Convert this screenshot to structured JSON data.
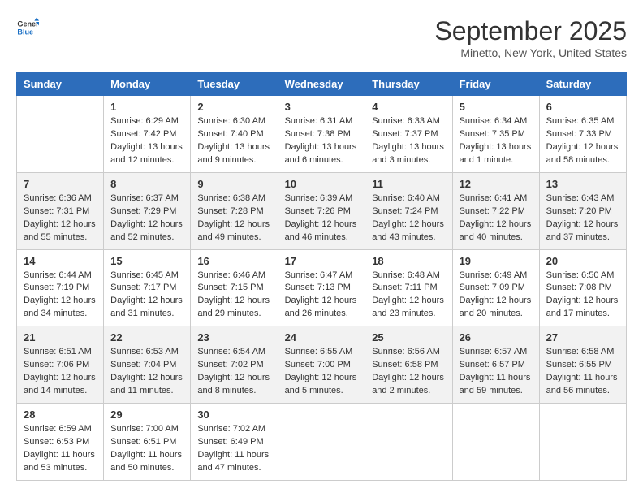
{
  "header": {
    "logo_line1": "General",
    "logo_line2": "Blue",
    "month": "September 2025",
    "location": "Minetto, New York, United States"
  },
  "weekdays": [
    "Sunday",
    "Monday",
    "Tuesday",
    "Wednesday",
    "Thursday",
    "Friday",
    "Saturday"
  ],
  "weeks": [
    [
      {
        "day": "",
        "sunrise": "",
        "sunset": "",
        "daylight": ""
      },
      {
        "day": "1",
        "sunrise": "Sunrise: 6:29 AM",
        "sunset": "Sunset: 7:42 PM",
        "daylight": "Daylight: 13 hours and 12 minutes."
      },
      {
        "day": "2",
        "sunrise": "Sunrise: 6:30 AM",
        "sunset": "Sunset: 7:40 PM",
        "daylight": "Daylight: 13 hours and 9 minutes."
      },
      {
        "day": "3",
        "sunrise": "Sunrise: 6:31 AM",
        "sunset": "Sunset: 7:38 PM",
        "daylight": "Daylight: 13 hours and 6 minutes."
      },
      {
        "day": "4",
        "sunrise": "Sunrise: 6:33 AM",
        "sunset": "Sunset: 7:37 PM",
        "daylight": "Daylight: 13 hours and 3 minutes."
      },
      {
        "day": "5",
        "sunrise": "Sunrise: 6:34 AM",
        "sunset": "Sunset: 7:35 PM",
        "daylight": "Daylight: 13 hours and 1 minute."
      },
      {
        "day": "6",
        "sunrise": "Sunrise: 6:35 AM",
        "sunset": "Sunset: 7:33 PM",
        "daylight": "Daylight: 12 hours and 58 minutes."
      }
    ],
    [
      {
        "day": "7",
        "sunrise": "Sunrise: 6:36 AM",
        "sunset": "Sunset: 7:31 PM",
        "daylight": "Daylight: 12 hours and 55 minutes."
      },
      {
        "day": "8",
        "sunrise": "Sunrise: 6:37 AM",
        "sunset": "Sunset: 7:29 PM",
        "daylight": "Daylight: 12 hours and 52 minutes."
      },
      {
        "day": "9",
        "sunrise": "Sunrise: 6:38 AM",
        "sunset": "Sunset: 7:28 PM",
        "daylight": "Daylight: 12 hours and 49 minutes."
      },
      {
        "day": "10",
        "sunrise": "Sunrise: 6:39 AM",
        "sunset": "Sunset: 7:26 PM",
        "daylight": "Daylight: 12 hours and 46 minutes."
      },
      {
        "day": "11",
        "sunrise": "Sunrise: 6:40 AM",
        "sunset": "Sunset: 7:24 PM",
        "daylight": "Daylight: 12 hours and 43 minutes."
      },
      {
        "day": "12",
        "sunrise": "Sunrise: 6:41 AM",
        "sunset": "Sunset: 7:22 PM",
        "daylight": "Daylight: 12 hours and 40 minutes."
      },
      {
        "day": "13",
        "sunrise": "Sunrise: 6:43 AM",
        "sunset": "Sunset: 7:20 PM",
        "daylight": "Daylight: 12 hours and 37 minutes."
      }
    ],
    [
      {
        "day": "14",
        "sunrise": "Sunrise: 6:44 AM",
        "sunset": "Sunset: 7:19 PM",
        "daylight": "Daylight: 12 hours and 34 minutes."
      },
      {
        "day": "15",
        "sunrise": "Sunrise: 6:45 AM",
        "sunset": "Sunset: 7:17 PM",
        "daylight": "Daylight: 12 hours and 31 minutes."
      },
      {
        "day": "16",
        "sunrise": "Sunrise: 6:46 AM",
        "sunset": "Sunset: 7:15 PM",
        "daylight": "Daylight: 12 hours and 29 minutes."
      },
      {
        "day": "17",
        "sunrise": "Sunrise: 6:47 AM",
        "sunset": "Sunset: 7:13 PM",
        "daylight": "Daylight: 12 hours and 26 minutes."
      },
      {
        "day": "18",
        "sunrise": "Sunrise: 6:48 AM",
        "sunset": "Sunset: 7:11 PM",
        "daylight": "Daylight: 12 hours and 23 minutes."
      },
      {
        "day": "19",
        "sunrise": "Sunrise: 6:49 AM",
        "sunset": "Sunset: 7:09 PM",
        "daylight": "Daylight: 12 hours and 20 minutes."
      },
      {
        "day": "20",
        "sunrise": "Sunrise: 6:50 AM",
        "sunset": "Sunset: 7:08 PM",
        "daylight": "Daylight: 12 hours and 17 minutes."
      }
    ],
    [
      {
        "day": "21",
        "sunrise": "Sunrise: 6:51 AM",
        "sunset": "Sunset: 7:06 PM",
        "daylight": "Daylight: 12 hours and 14 minutes."
      },
      {
        "day": "22",
        "sunrise": "Sunrise: 6:53 AM",
        "sunset": "Sunset: 7:04 PM",
        "daylight": "Daylight: 12 hours and 11 minutes."
      },
      {
        "day": "23",
        "sunrise": "Sunrise: 6:54 AM",
        "sunset": "Sunset: 7:02 PM",
        "daylight": "Daylight: 12 hours and 8 minutes."
      },
      {
        "day": "24",
        "sunrise": "Sunrise: 6:55 AM",
        "sunset": "Sunset: 7:00 PM",
        "daylight": "Daylight: 12 hours and 5 minutes."
      },
      {
        "day": "25",
        "sunrise": "Sunrise: 6:56 AM",
        "sunset": "Sunset: 6:58 PM",
        "daylight": "Daylight: 12 hours and 2 minutes."
      },
      {
        "day": "26",
        "sunrise": "Sunrise: 6:57 AM",
        "sunset": "Sunset: 6:57 PM",
        "daylight": "Daylight: 11 hours and 59 minutes."
      },
      {
        "day": "27",
        "sunrise": "Sunrise: 6:58 AM",
        "sunset": "Sunset: 6:55 PM",
        "daylight": "Daylight: 11 hours and 56 minutes."
      }
    ],
    [
      {
        "day": "28",
        "sunrise": "Sunrise: 6:59 AM",
        "sunset": "Sunset: 6:53 PM",
        "daylight": "Daylight: 11 hours and 53 minutes."
      },
      {
        "day": "29",
        "sunrise": "Sunrise: 7:00 AM",
        "sunset": "Sunset: 6:51 PM",
        "daylight": "Daylight: 11 hours and 50 minutes."
      },
      {
        "day": "30",
        "sunrise": "Sunrise: 7:02 AM",
        "sunset": "Sunset: 6:49 PM",
        "daylight": "Daylight: 11 hours and 47 minutes."
      },
      {
        "day": "",
        "sunrise": "",
        "sunset": "",
        "daylight": ""
      },
      {
        "day": "",
        "sunrise": "",
        "sunset": "",
        "daylight": ""
      },
      {
        "day": "",
        "sunrise": "",
        "sunset": "",
        "daylight": ""
      },
      {
        "day": "",
        "sunrise": "",
        "sunset": "",
        "daylight": ""
      }
    ]
  ]
}
